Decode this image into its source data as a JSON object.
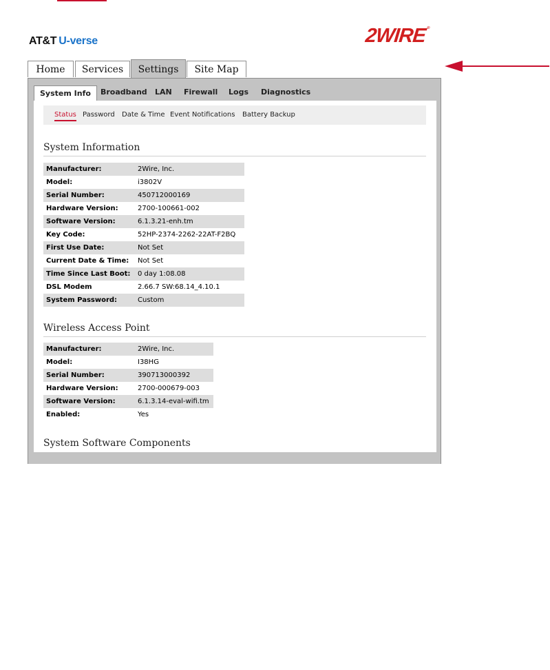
{
  "brand": {
    "att": "AT&T",
    "uverse": "U-verse",
    "twowire": "2WIRE",
    "tm": "®"
  },
  "main_tabs": [
    {
      "label": "Home",
      "active": false
    },
    {
      "label": "Services",
      "active": false
    },
    {
      "label": "Settings",
      "active": true
    },
    {
      "label": "Site Map",
      "active": false
    }
  ],
  "sub_tabs": [
    {
      "label": "System Info",
      "active": true
    },
    {
      "label": "Broadband",
      "active": false
    },
    {
      "label": "LAN",
      "active": false
    },
    {
      "label": "Firewall",
      "active": false
    },
    {
      "label": "Logs",
      "active": false
    },
    {
      "label": "Diagnostics",
      "active": false
    }
  ],
  "subnav": [
    {
      "label": "Status",
      "active": true
    },
    {
      "label": "Password",
      "active": false
    },
    {
      "label": "Date & Time",
      "active": false
    },
    {
      "label": "Event Notifications",
      "active": false
    },
    {
      "label": "Battery Backup",
      "active": false
    }
  ],
  "sections": {
    "system_info": {
      "title": "System Information",
      "rows": [
        {
          "label": "Manufacturer:",
          "value": "2Wire, Inc."
        },
        {
          "label": "Model:",
          "value": "i3802V"
        },
        {
          "label": "Serial Number:",
          "value": "450712000169"
        },
        {
          "label": "Hardware Version:",
          "value": "2700-100661-002"
        },
        {
          "label": "Software Version:",
          "value": "6.1.3.21-enh.tm"
        },
        {
          "label": "Key Code:",
          "value": "52HP-2374-2262-22AT-F2BQ"
        },
        {
          "label": "First Use Date:",
          "value": "Not Set"
        },
        {
          "label": "Current Date & Time:",
          "value": "Not Set"
        },
        {
          "label": "Time Since Last Boot:",
          "value": "0 day 1:08.08"
        },
        {
          "label": "DSL Modem",
          "value": "2.66.7 SW:68.14_4.10.1"
        },
        {
          "label": "System Password:",
          "value": "Custom"
        }
      ]
    },
    "wireless_ap": {
      "title": "Wireless Access Point",
      "rows": [
        {
          "label": "Manufacturer:",
          "value": "2Wire, Inc."
        },
        {
          "label": "Model:",
          "value": "I38HG"
        },
        {
          "label": "Serial Number:",
          "value": "390713000392"
        },
        {
          "label": "Hardware Version:",
          "value": "2700-000679-003"
        },
        {
          "label": "Software Version:",
          "value": "6.1.3.14-eval-wifi.tm"
        },
        {
          "label": "Enabled:",
          "value": "Yes"
        }
      ]
    },
    "software_components": {
      "title": "System Software Components"
    }
  },
  "colors": {
    "brand_red": "#d11f1f",
    "uverse_blue": "#1a73c9",
    "active_tab_gray": "#c3c3c3"
  },
  "icons": {
    "arrow": "left-arrow-icon"
  }
}
